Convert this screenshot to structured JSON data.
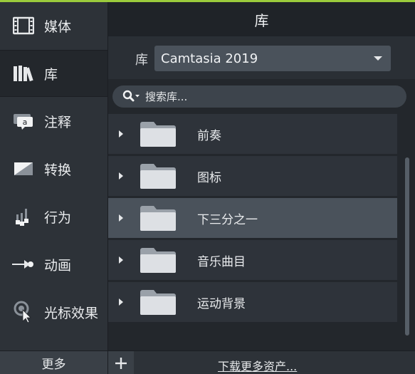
{
  "colors": {
    "accent": "#9bcb3c",
    "selected_row": "#4a525b"
  },
  "sidebar": {
    "items": [
      {
        "label": "媒体",
        "icon": "film-icon"
      },
      {
        "label": "库",
        "icon": "library-books-icon"
      },
      {
        "label": "注释",
        "icon": "callout-icon"
      },
      {
        "label": "转换",
        "icon": "transition-icon"
      },
      {
        "label": "行为",
        "icon": "behavior-icon"
      },
      {
        "label": "动画",
        "icon": "animation-arrow-icon"
      },
      {
        "label": "光标效果",
        "icon": "cursor-effect-icon"
      }
    ],
    "active_index": 1,
    "more_label": "更多"
  },
  "panel": {
    "title": "库",
    "library_label": "库",
    "library_selected": "Camtasia 2019",
    "search_placeholder": "搜索库...",
    "folders": [
      {
        "name": "前奏"
      },
      {
        "name": "图标"
      },
      {
        "name": "下三分之一"
      },
      {
        "name": "音乐曲目"
      },
      {
        "name": "运动背景"
      }
    ],
    "selected_folder_index": 2,
    "download_more": "下载更多资产..."
  }
}
